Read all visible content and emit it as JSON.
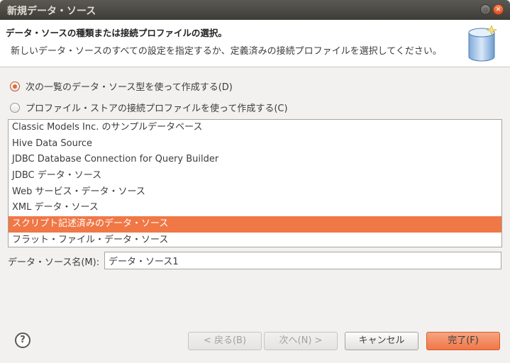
{
  "window": {
    "title": "新規データ・ソース"
  },
  "header": {
    "title": "データ・ソースの種類または接続プロファイルの選択。",
    "description": "新しいデータ・ソースのすべての設定を指定するか、定義済みの接続プロファイルを選択してください。",
    "icon": "database-icon"
  },
  "options": [
    {
      "label": "次の一覧のデータ・ソース型を使って作成する(D)",
      "checked": true
    },
    {
      "label": "プロファイル・ストアの接続プロファイルを使って作成する(C)",
      "checked": false
    }
  ],
  "data_source_types": [
    "Classic Models Inc. のサンプルデータベース",
    "Hive Data Source",
    "JDBC Database Connection for Query Builder",
    "JDBC データ・ソース",
    "Web サービス・データ・ソース",
    "XML データ・ソース",
    "スクリプト記述済みのデータ・ソース",
    "フラット・ファイル・データ・ソース"
  ],
  "selected_index": 6,
  "name_field": {
    "label": "データ・ソース名(M):",
    "value": "データ・ソース1"
  },
  "buttons": {
    "help": "?",
    "back": "< 戻る(B)",
    "next": "次へ(N) >",
    "cancel": "キャンセル",
    "finish": "完了(F)"
  },
  "colors": {
    "accent": "#f07746",
    "titlebar": "#3d3c38"
  }
}
